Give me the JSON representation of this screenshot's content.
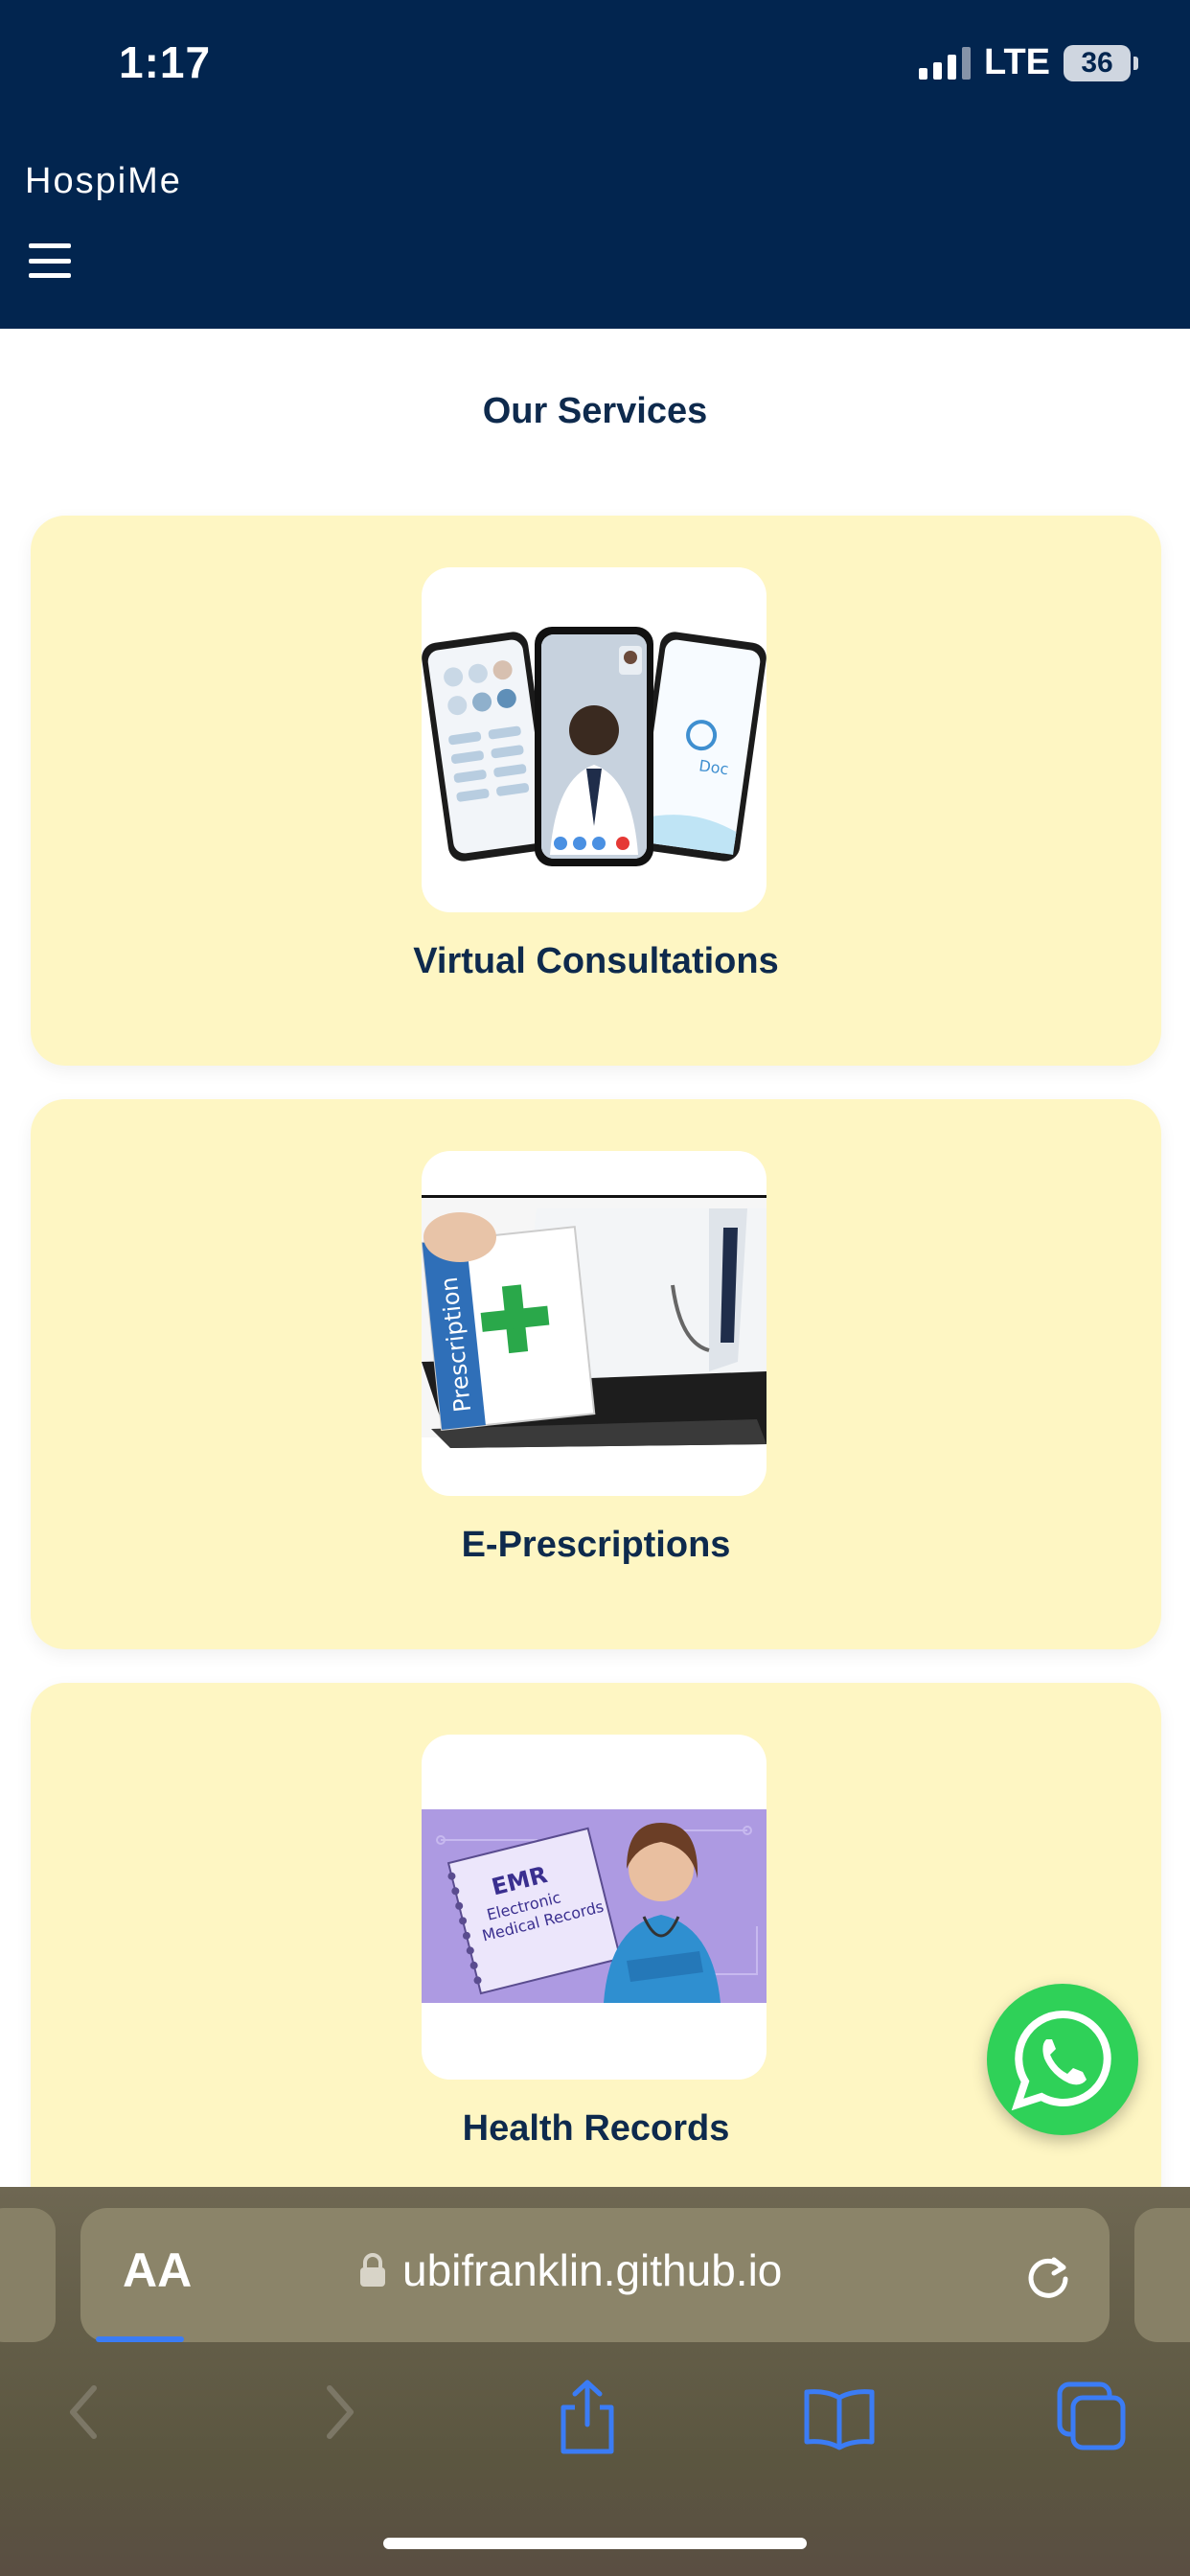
{
  "status_bar": {
    "time": "1:17",
    "network": "LTE",
    "battery": "36"
  },
  "header": {
    "brand": "HospiMe",
    "menu_icon": "hamburger-icon"
  },
  "section": {
    "title": "Our Services"
  },
  "services": [
    {
      "label": "Virtual Consultations",
      "image": "phones-doctor-video-call"
    },
    {
      "label": "E-Prescriptions",
      "image": "laptop-prescription-bag",
      "image_text": "Prescription"
    },
    {
      "label": "Health Records",
      "image": "emr-nurse",
      "image_text": [
        "EMR",
        "Electronic",
        "Medical Records"
      ]
    }
  ],
  "floating": {
    "icon": "whatsapp-icon",
    "color": "#2fd158"
  },
  "browser": {
    "text_size_label": "AA",
    "url": "ubifranklin.github.io",
    "icons": [
      "back-icon",
      "forward-icon",
      "share-icon",
      "bookmarks-icon",
      "tabs-icon"
    ],
    "accent": "#3b7cf5"
  },
  "colors": {
    "header": "#02254f",
    "card": "#fef6c3",
    "text": "#0e2a4d"
  }
}
